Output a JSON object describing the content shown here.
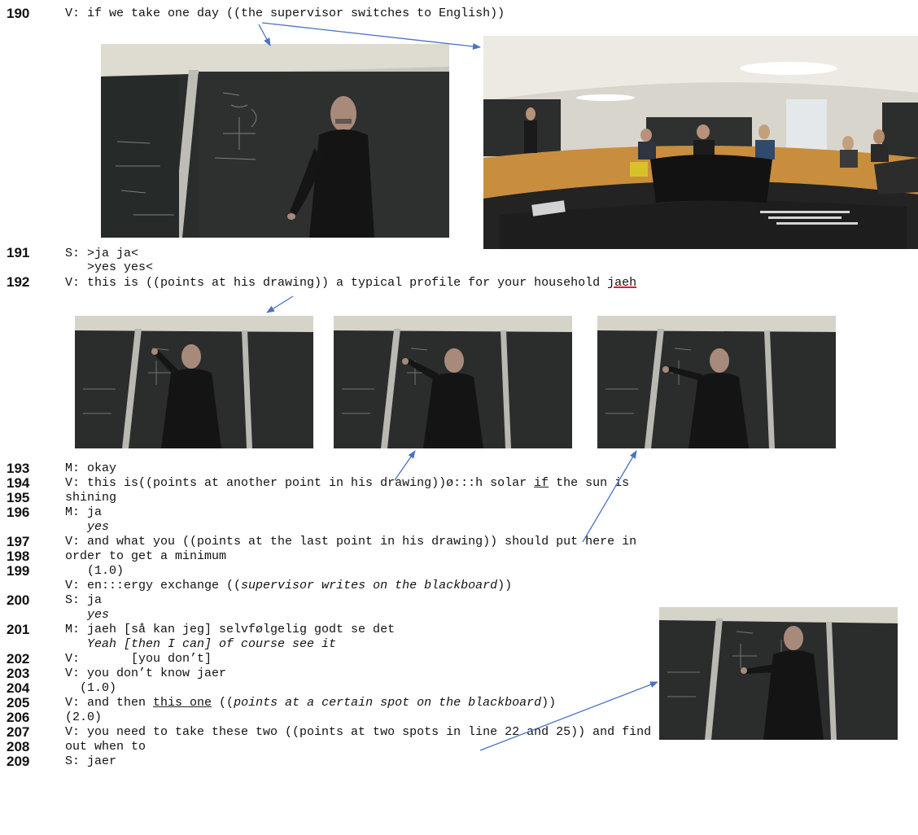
{
  "lines": {
    "l190": {
      "num": "190",
      "text": "V: if we take one day ((the supervisor switches to English))"
    },
    "l191": {
      "num": "191",
      "text": "S: >ja ja<"
    },
    "l191_tr": {
      "text": "   >yes yes<"
    },
    "l192": {
      "num": "192",
      "pre": "V: this is ((points at his drawing)) a typical profile for your household ",
      "red": "jaeh"
    },
    "l193": {
      "num": "193",
      "text": "M: okay"
    },
    "l194": {
      "num": "194",
      "pre": "V: this is((points at another point in his drawing))ø:::h solar ",
      "ul": "if",
      "post": " the sun is"
    },
    "l195": {
      "num": "195",
      "text": "shining"
    },
    "l196": {
      "num": "196",
      "text": "M: ja"
    },
    "l196_tr": {
      "text": "   yes"
    },
    "l197": {
      "num": "197",
      "text": "V: and what you ((points at the last point in his drawing)) should put here in"
    },
    "l198": {
      "num": "198",
      "text": "order to get a minimum"
    },
    "l199": {
      "num": "199",
      "text": "   (1.0)"
    },
    "l199b": {
      "pre": "V: en:::ergy exchange ((",
      "it": "supervisor writes on the blackboard",
      "post": "))"
    },
    "l200": {
      "num": "200",
      "text": "S: ja"
    },
    "l200_tr": {
      "text": "   yes"
    },
    "l201": {
      "num": "201",
      "text": "M: jaeh [så kan jeg] selvfølgelig godt se det"
    },
    "l201_tr": {
      "text": "   Yeah [then I can] of course see it"
    },
    "l202": {
      "num": "202",
      "text": "V:       [you don’t]"
    },
    "l203": {
      "num": "203",
      "text": "V: you don’t know jaer"
    },
    "l204": {
      "num": "204",
      "text": "  (1.0)"
    },
    "l205": {
      "num": "205",
      "pre": "V: and then ",
      "ul": "this one",
      "mid": " ((",
      "it": "points at a certain spot on the blackboard",
      "post": "))"
    },
    "l206": {
      "num": "206",
      "text": "(2.0)"
    },
    "l207": {
      "num": "207",
      "text": "V: you need to take these two ((points at two spots in line 22 and 25)) and find"
    },
    "l208": {
      "num": "208",
      "text": "out when to"
    },
    "l209": {
      "num": "209",
      "text": "S: jaer"
    }
  },
  "colors": {
    "arrow": "#4a72c4",
    "blackboard": "#2a2d2c",
    "jacket": "#141414",
    "wall": "#d9d6cc"
  }
}
